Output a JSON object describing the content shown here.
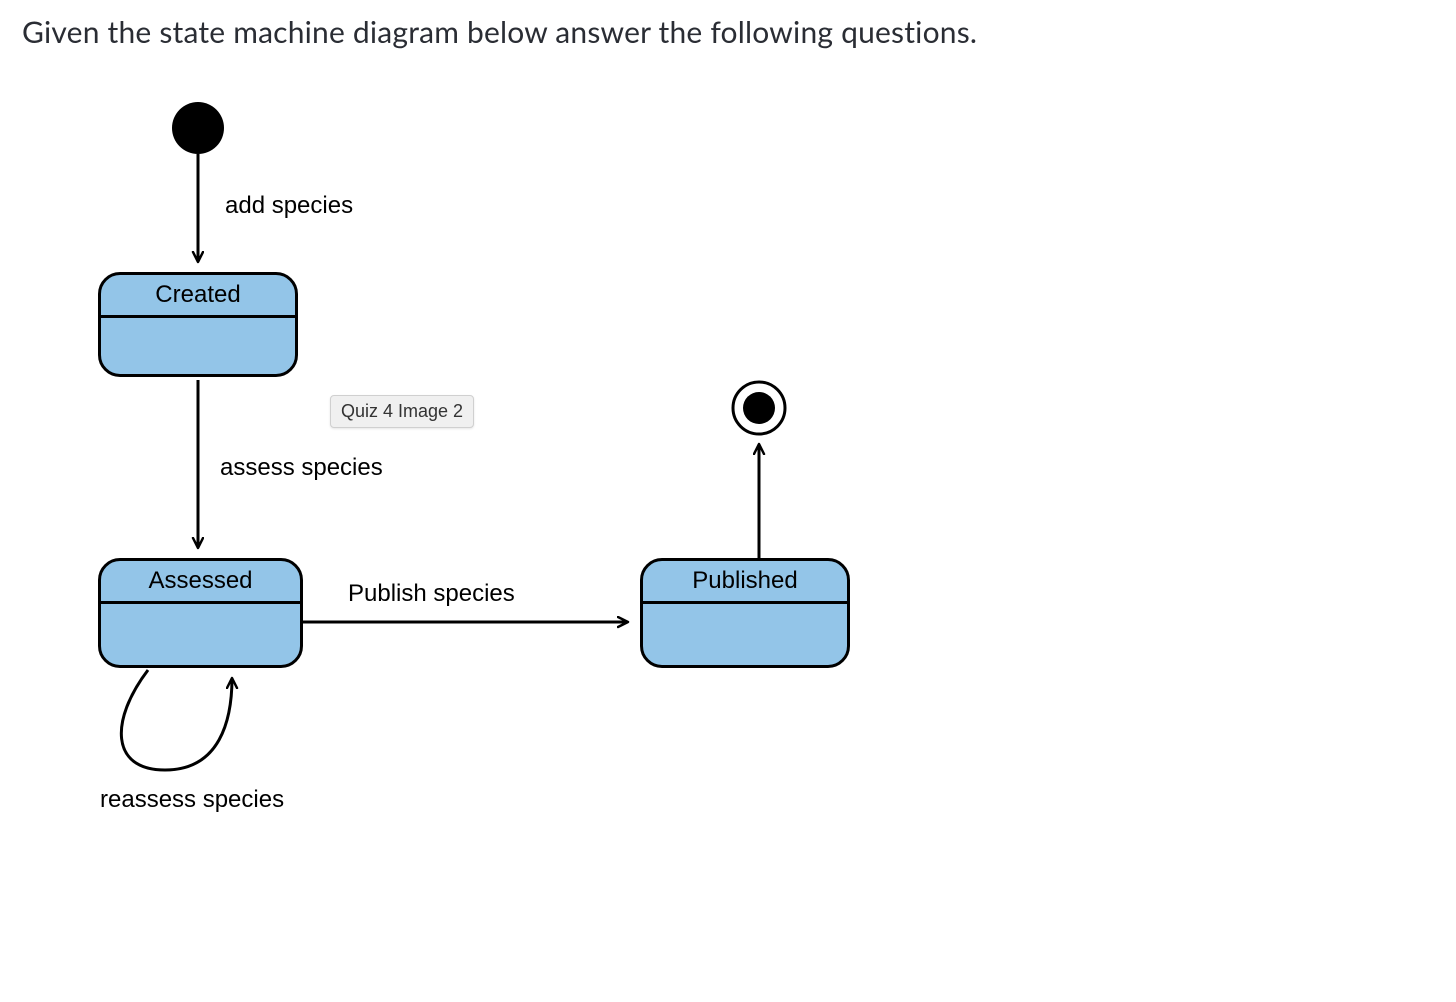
{
  "title": "Given the state machine diagram below answer the following questions.",
  "states": {
    "created": "Created",
    "assessed": "Assessed",
    "published": "Published"
  },
  "transitions": {
    "add_species": "add species",
    "assess_species": "assess species",
    "publish_species": "Publish species",
    "reassess_species": "reassess species"
  },
  "tooltip": "Quiz 4 Image 2"
}
